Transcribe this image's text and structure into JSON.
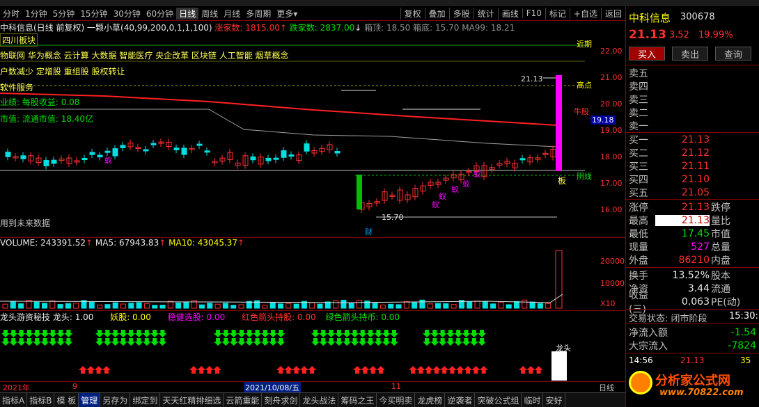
{
  "toolbar": {
    "periods": [
      "分时",
      "1分钟",
      "5分钟",
      "15分钟",
      "30分钟",
      "60分钟",
      "日线",
      "周线",
      "月线",
      "多周期",
      "更多"
    ],
    "active_period": "日线",
    "more_arrow": "▾",
    "buttons": [
      "复权",
      "叠加",
      "多股",
      "统计",
      "画线",
      "F10",
      "标记",
      "+自选",
      "返回"
    ]
  },
  "title_line": {
    "stock": "中科信息(日线 前复权)",
    "formula": "一颗小草(40,99,200,0,1,1,100)",
    "limit_up": "涨家数: 1815.00",
    "limit_up_arrow": "↑",
    "limit_down": "跌家数: 2837.00",
    "limit_down_arrow": "↓",
    "top": "箱顶: 18.50",
    "bottom": "箱底: 15.70",
    "ma99": "MA99: 18.21"
  },
  "concepts": [
    "四川板块",
    "物联网 华为概念 云计算 大数据 智能医疗 央企改革 区块链 人工智能 烟草概念",
    "户数减少 定增股 重组股 股权转让",
    "软件服务"
  ],
  "fundamentals": {
    "eps": "业绩: 每股收益: 0.08",
    "market_value": "市值: 流通市值: 18.40亿"
  },
  "chart_notes": {
    "future_data": "用到未来数据",
    "cai": "财",
    "ban": "板",
    "high_note": "21.13",
    "low_note": "15.70",
    "gao": "高点",
    "niu": "牛股",
    "yin": "阴线",
    "near": "近期",
    "ant": "蚁"
  },
  "price_axis": [
    "22.00",
    "21.00",
    "20.00",
    "19.00",
    "18.00",
    "17.00",
    "16.00"
  ],
  "crosshair_price": "19.18",
  "volume_line": {
    "volume": "VOLUME: 243391.52",
    "ma5": "MA5: 67943.83",
    "ma10": "MA10: 43045.37",
    "arrow": "↑"
  },
  "volume_axis": [
    "20000",
    "10000",
    "X10"
  ],
  "indicator_line": {
    "name": "龙头游资秘技",
    "longtou": "龙头: 1.00",
    "yaogu": "妖股: 0.00",
    "wenjian": "稳健选股: 0.00",
    "red_arrow": "红色箭头持股: 0.00",
    "green_arrow": "绿色箭头持币: 0.00",
    "longtou_label": "龙头"
  },
  "time_axis": {
    "year": "2021年",
    "m9": "9",
    "date": "2021/10/08/五",
    "m11": "11",
    "day_label": "日线"
  },
  "bottom_tabs": [
    "指标A",
    "指标B",
    "模 板",
    "管理",
    "另存为",
    "绑定到",
    "天天红精排细选",
    "云箭重能",
    "刻舟求剑",
    "龙头战法",
    "筹码之王",
    "今买明卖",
    "龙虎榜",
    "逆袭者",
    "突破公式组",
    "临时",
    "安好"
  ],
  "active_tab": "管理",
  "quote": {
    "name": "中科信息",
    "code": "300678",
    "price": "21.13",
    "change": "3.52",
    "pct": "19.99%",
    "buy_btn": "买入",
    "sell_btn": "卖出",
    "query_btn": "查询",
    "sell_levels": [
      "卖五",
      "卖四",
      "卖三",
      "卖二",
      "卖一"
    ],
    "buy_levels": [
      {
        "label": "买一",
        "price": "21.13"
      },
      {
        "label": "买二",
        "price": "21.12"
      },
      {
        "label": "买三",
        "price": "21.11"
      },
      {
        "label": "买四",
        "price": "21.10"
      },
      {
        "label": "买五",
        "price": "21.05"
      }
    ],
    "stats": [
      {
        "l1": "涨停",
        "v1": "21.13",
        "l2": "跌停",
        "v2": ""
      },
      {
        "l1": "最高",
        "v1": "21.13",
        "l2": "量比",
        "v2": ""
      },
      {
        "l1": "最低",
        "v1": "17.45",
        "l2": "市值",
        "v2": ""
      },
      {
        "l1": "现量",
        "v1": "527",
        "l2": "总量",
        "v2": ""
      },
      {
        "l1": "外盘",
        "v1": "86210",
        "l2": "内盘",
        "v2": ""
      }
    ],
    "fin": [
      {
        "l1": "换手",
        "v1": "13.52%",
        "l2": "股本"
      },
      {
        "l1": "净资",
        "v1": "3.44",
        "l2": "流通"
      },
      {
        "l1": "收益(三)",
        "v1": "0.063",
        "l2": "PE(动)"
      }
    ],
    "trade_status": "交易状态: 闭市阶段",
    "time_now": "15:30:",
    "net_inflow_label": "净流入额",
    "net_inflow": "-1.54",
    "block_label": "大宗流入",
    "block_inflow": "-7824",
    "tick_time": "14:56",
    "tick_price": "21.13",
    "tick_vol": "35",
    "logo_text": "分析家公式网",
    "logo_url": "www.70822.com"
  },
  "colors": {
    "up": "#ff3030",
    "down": "#00e0e0",
    "ma_red": "#ff2020",
    "magenta": "#ff00ff"
  }
}
